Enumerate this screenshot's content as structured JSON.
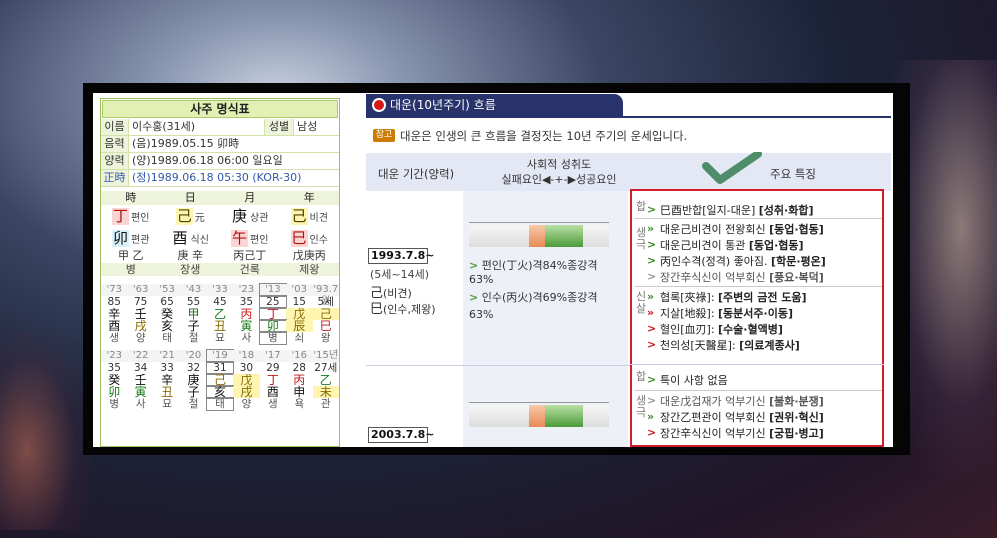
{
  "left": {
    "title": "사주 명식표",
    "info": {
      "name_label": "이름",
      "name_value": "이수홍(31세)",
      "gender_label": "성별",
      "gender_value": "남성",
      "lunar_label": "음력",
      "lunar_value": "(음)1989.05.15 卯時",
      "solar_label": "양력",
      "solar_value": "(양)1989.06.18 06:00 일요일",
      "correct_label": "正時",
      "correct_value": "(정)1989.06.18 05:30 (KOR-30)"
    },
    "pillars": {
      "headers": [
        "時",
        "日",
        "月",
        "年"
      ],
      "stems": [
        {
          "char": "丁",
          "god": "편인"
        },
        {
          "char": "己",
          "god": "元"
        },
        {
          "char": "庚",
          "god": "상관"
        },
        {
          "char": "己",
          "god": "비견"
        }
      ],
      "branches": [
        {
          "char": "卯",
          "god": "편관"
        },
        {
          "char": "酉",
          "god": "식신"
        },
        {
          "char": "午",
          "god": "편인"
        },
        {
          "char": "巳",
          "god": "인수"
        }
      ],
      "hidden": [
        "甲 乙",
        "庚 辛",
        "丙己丁",
        "戊庚丙"
      ],
      "stages": [
        "병",
        "장생",
        "건록",
        "제왕"
      ]
    },
    "luck_grid_1": {
      "years": [
        "'73",
        "'63",
        "'53",
        "'43",
        "'33",
        "'23",
        "'13",
        "'03",
        "'93.7월"
      ],
      "ages": [
        "85",
        "75",
        "65",
        "55",
        "45",
        "35",
        "25",
        "15",
        "5세"
      ],
      "stems": [
        "辛",
        "壬",
        "癸",
        "甲",
        "乙",
        "丙",
        "丁",
        "戊",
        "己"
      ],
      "branches": [
        "酉",
        "戌",
        "亥",
        "子",
        "丑",
        "寅",
        "卯",
        "辰",
        "巳"
      ],
      "stages": [
        "생",
        "양",
        "태",
        "절",
        "묘",
        "사",
        "병",
        "쇠",
        "왕"
      ]
    },
    "luck_grid_2": {
      "years": [
        "'23",
        "'22",
        "'21",
        "'20",
        "'19",
        "'18",
        "'17",
        "'16",
        "'15년"
      ],
      "ages": [
        "35",
        "34",
        "33",
        "32",
        "31",
        "30",
        "29",
        "28",
        "27세"
      ],
      "stems": [
        "癸",
        "壬",
        "辛",
        "庚",
        "己",
        "戊",
        "丁",
        "丙",
        "乙"
      ],
      "branches": [
        "卯",
        "寅",
        "丑",
        "子",
        "亥",
        "戌",
        "酉",
        "申",
        "未"
      ],
      "stages": [
        "병",
        "사",
        "묘",
        "절",
        "태",
        "양",
        "생",
        "욕",
        "관"
      ]
    }
  },
  "right": {
    "tab_title": "대운(10년주기) 흐름",
    "ref_badge": "참고",
    "description": "대운은 인생의 큰 흐름을 결정짓는 10년 주기의 운세입니다.",
    "headers": {
      "period": "대운 기간(양력)",
      "achieve_line1": "사회적 성취도",
      "achieve_line2": "실패요인◀-+-▶성공요인",
      "features": "주요 특징"
    },
    "rows": [
      {
        "period": "1993.7.8~",
        "age": "(5세~14세)",
        "stem_char": "己",
        "stem_note": "(비견)",
        "branch_char": "巳",
        "branch_note": "(인수,제왕)",
        "bar_text1": "편인(丁火)격84%종강격",
        "bar_pct1": "63%",
        "bar_text2": "인수(丙火)격69%종강격",
        "bar_pct2": "63%"
      },
      {
        "period": "2003.7.8~"
      }
    ],
    "sections": {
      "hap_label": "합",
      "saeng_label": "생극",
      "sinsal_label": "신살"
    },
    "features": [
      {
        "a": "巳酉반합[일지-대운] ",
        "b": "[성취·화합]"
      },
      {
        "a": "대운己비견이 전왕회신 ",
        "b": "[동업·협동]"
      },
      {
        "a": "대운己비견이 통관 ",
        "b": "[동업·협동]"
      },
      {
        "a": "丙인수격(정격) 좋아짐. ",
        "b": "[학문·평온]"
      },
      {
        "a": "장간辛식신이 억부회신 ",
        "b": "[풍요·복덕]"
      },
      {
        "a": "협록[夾祿]: ",
        "b": "[주변의 금전 도움]"
      },
      {
        "a": "지살[地殺]: ",
        "b": "[동분서주·이동]"
      },
      {
        "a": "혈인[血刃]: ",
        "b": "[수술·혈액병]"
      },
      {
        "a": "천의성[天醫星]: ",
        "b": "[의료계종사]"
      },
      {
        "a": "특이 사항 없음",
        "b": ""
      },
      {
        "a": "대운戊겁재가 억부기신 ",
        "b": "[불화·분쟁]"
      },
      {
        "a": "장간乙편관이 억부회신 ",
        "b": "[권위·혁신]"
      },
      {
        "a": "장간辛식신이 억부기신 ",
        "b": "[궁핍·병고]"
      }
    ]
  },
  "colors": {
    "panel_border": "#9bbf59",
    "tab_bg": "#27336a",
    "highlight_box": "#d11d2b",
    "check_mark": "#4f8d6a"
  }
}
